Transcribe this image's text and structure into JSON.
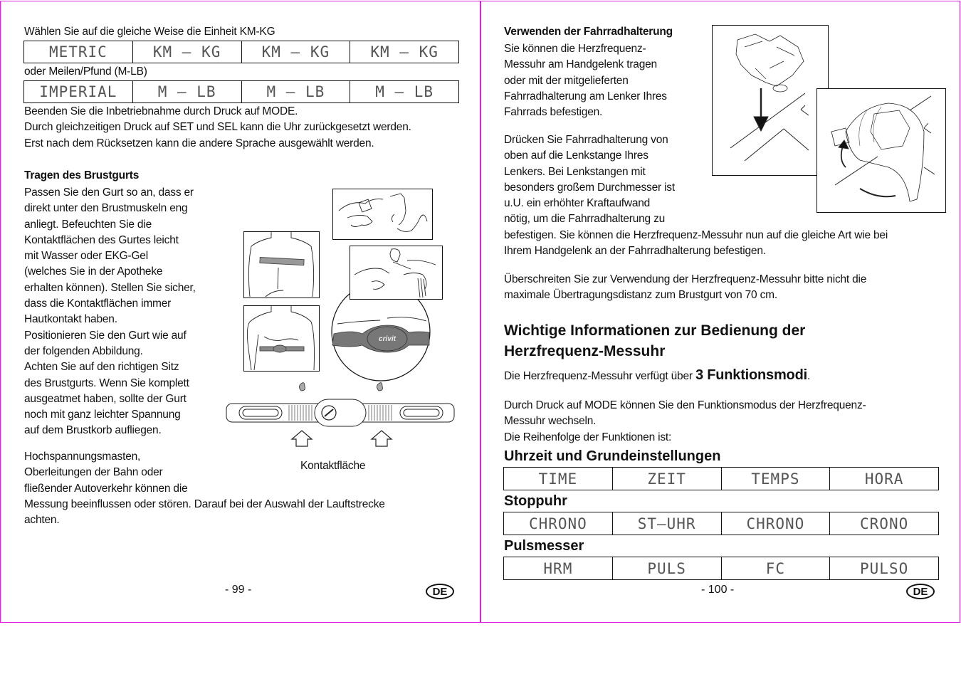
{
  "left_page": {
    "intro_kmkg": "Wählen Sie auf die gleiche Weise die Einheit KM-KG",
    "metric_row": [
      "METRIC",
      "KM – KG",
      "KM – KG",
      "KM – KG"
    ],
    "intro_mlb": "oder Meilen/Pfund (M-LB)",
    "imperial_row": [
      "IMPERIAL",
      "M – LB",
      "M – LB",
      "M – LB"
    ],
    "finish_lines": [
      "Beenden Sie die Inbetriebnahme durch Druck auf MODE.",
      "Durch gleichzeitigen Druck auf SET und SEL kann die Uhr zurückgesetzt werden.",
      "Erst nach dem Rücksetzen kann die andere Sprache ausgewählt werden."
    ],
    "strap_heading": "Tragen des Brustgurts",
    "strap_lines": [
      "Passen Sie den Gurt so an, dass er",
      "direkt unter den Brustmuskeln eng",
      "anliegt. Befeuchten Sie die",
      "Kontaktflächen des Gurtes leicht",
      "mit Wasser oder EKG-Gel",
      "(welches Sie in der Apotheke",
      "erhalten können). Stellen Sie sicher,",
      "dass die Kontaktflächen immer",
      "Hautkontakt haben.",
      "Positionieren Sie den Gurt wie auf",
      "der folgenden Abbildung.",
      "Achten Sie auf den richtigen Sitz",
      "des Brustgurts. Wenn Sie komplett",
      "ausgeatmet haben, sollte der Gurt",
      "noch mit ganz leichter Spannung",
      "auf dem Brustkorb aufliegen."
    ],
    "interference_lines": [
      "Hochspannungsmasten,",
      "Oberleitungen der Bahn oder",
      "fließender Autoverkehr können die",
      "Messung beeinflussen oder stören. Darauf bei der Auswahl der Lauftstrecke",
      "achten."
    ],
    "figure_caption": "Kontaktfläche",
    "brand_label": "crivit",
    "page_number": "- 99 -",
    "lang_badge": "DE"
  },
  "right_page": {
    "bike_heading": "Verwenden der Fahrradhalterung",
    "bike_lines_1": [
      "Sie können die Herzfrequenz-",
      "Messuhr am Handgelenk tragen",
      "oder mit der mitgelieferten",
      "Fahrradhalterung am Lenker Ihres",
      "Fahrrads befestigen."
    ],
    "bike_lines_2": [
      "Drücken Sie Fahrradhalterung von",
      "oben auf die Lenkstange Ihres",
      "Lenkers. Bei Lenkstangen mit",
      "besonders großem Durchmesser ist",
      "u.U. ein erhöhter Kraftaufwand",
      "nötig, um die Fahrradhalterung zu",
      "befestigen. Sie können die Herzfrequenz-Messuhr nun auf die gleiche Art wie bei",
      "Ihrem Handgelenk an der Fahrradhalterung befestigen."
    ],
    "distance_lines": [
      "Überschreiten Sie zur Verwendung der Herzfrequenz-Messuhr bitte nicht die",
      "maximale Übertragungsdistanz zum Brustgurt von 70 cm."
    ],
    "section_title_1": "Wichtige Informationen zur Bedienung der",
    "section_title_2": "Herzfrequenz-Messuhr",
    "modes_intro": "Die Herzfrequenz-Messuhr verfügt über ",
    "modes_bold": "3 Funktionsmodi",
    "modes_end": ".",
    "mode_lines": [
      "Durch Druck auf MODE können Sie den Funktionsmodus der Herzfrequenz-",
      "Messuhr wechseln.",
      "Die Reihenfolge der Funktionen ist:"
    ],
    "modes": [
      {
        "title": "Uhrzeit und Grundeinstellungen",
        "row": [
          "TIME",
          "ZEIT",
          "TEMPS",
          "HORA"
        ]
      },
      {
        "title": "Stoppuhr",
        "row": [
          "CHRONO",
          "ST–UHR",
          "CHRONO",
          "CRONO"
        ]
      },
      {
        "title": "Pulsmesser",
        "row": [
          "HRM",
          "PULS",
          "FC",
          "PULSO"
        ]
      }
    ],
    "page_number": "- 100 -",
    "lang_badge": "DE"
  }
}
